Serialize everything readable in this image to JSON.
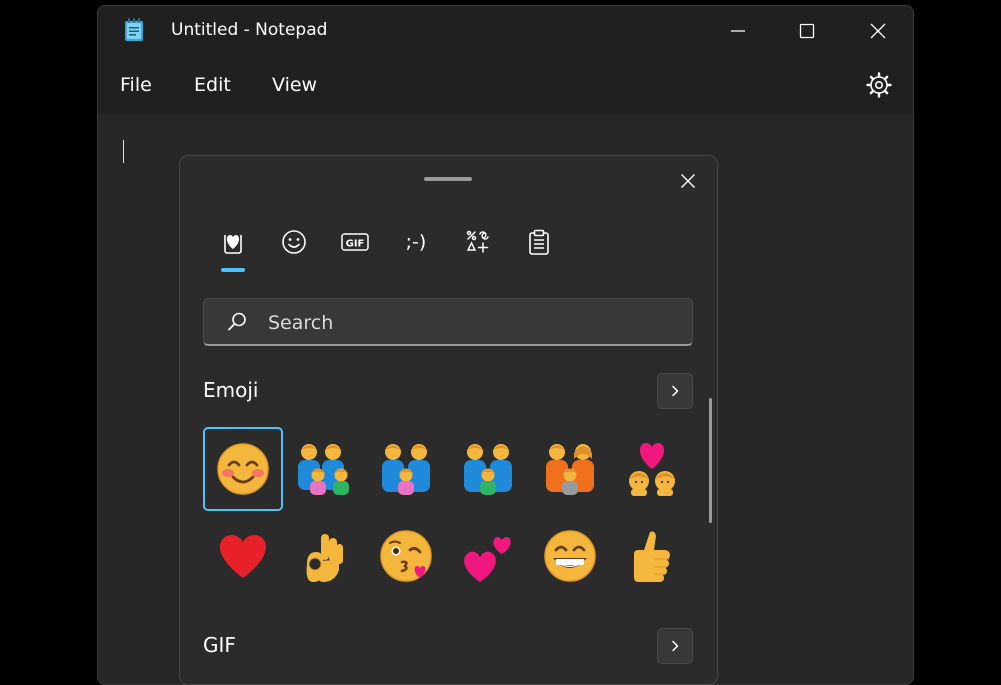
{
  "window": {
    "title": "Untitled - Notepad",
    "app_icon": "notepad-icon",
    "controls": [
      "minimize-icon",
      "maximize-icon",
      "close-icon"
    ]
  },
  "menu": {
    "items": [
      "File",
      "Edit",
      "View"
    ],
    "settings_icon": "gear-icon"
  },
  "editor": {
    "content": ""
  },
  "emoji_panel": {
    "tabs": [
      {
        "name": "recently-used",
        "label": "",
        "icon": "heart-clipboard-icon",
        "selected": true
      },
      {
        "name": "emoji",
        "label": "",
        "icon": "smiley-icon"
      },
      {
        "name": "gif",
        "label": "GIF",
        "icon": "gif-icon"
      },
      {
        "name": "kaomoji",
        "label": ";-)",
        "icon": "kaomoji-icon"
      },
      {
        "name": "symbols",
        "label": "",
        "icon": "symbols-icon"
      },
      {
        "name": "clipboard",
        "label": "",
        "icon": "clipboard-icon"
      }
    ],
    "search": {
      "placeholder": "Search",
      "value": "",
      "icon": "search-icon"
    },
    "sections": [
      {
        "title": "Emoji",
        "more_icon": "chevron-right-icon",
        "items": [
          {
            "name": "smiling-face-with-smiling-eyes",
            "char": "😊",
            "selected": true
          },
          {
            "name": "family-man-man-girl-boy",
            "char": "👨‍👨‍👧‍👦"
          },
          {
            "name": "family-man-man-girl",
            "char": "👨‍👨‍👧"
          },
          {
            "name": "family-man-man-boy",
            "char": "👨‍👨‍👦"
          },
          {
            "name": "family-man-woman-girl",
            "char": "👨‍👩‍👧"
          },
          {
            "name": "couple-with-heart",
            "char": "💑"
          },
          {
            "name": "red-heart",
            "char": "❤️"
          },
          {
            "name": "ok-hand",
            "char": "👌"
          },
          {
            "name": "face-blowing-a-kiss",
            "char": "😘"
          },
          {
            "name": "two-hearts",
            "char": "💕"
          },
          {
            "name": "grinning-face-with-smiling-eyes",
            "char": "😁"
          },
          {
            "name": "thumbs-up",
            "char": "👍"
          }
        ]
      },
      {
        "title": "GIF",
        "more_icon": "chevron-right-icon"
      }
    ]
  },
  "colors": {
    "accent": "#4cc2ff",
    "window_bg": "#202020",
    "editor_bg": "#272727",
    "panel_bg": "#2b2b2b"
  }
}
